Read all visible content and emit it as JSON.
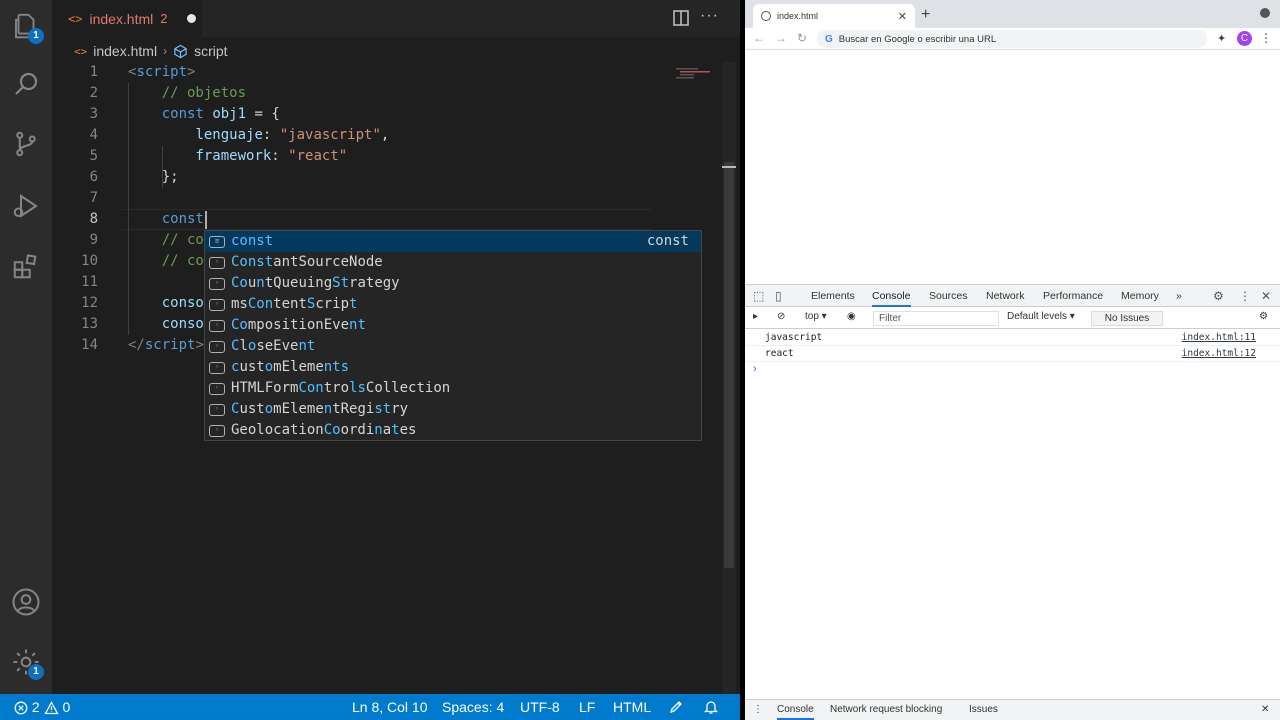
{
  "vscode": {
    "tab": {
      "icon": "<>",
      "name": "index.html",
      "problems": "2"
    },
    "breadcrumb": {
      "file": "index.html",
      "symbol": "script"
    },
    "activity": {
      "explorer_badge": "1",
      "settings_badge": "1"
    },
    "code_lines": [
      {
        "n": "1",
        "parts": [
          {
            "c": "t-tag",
            "t": "<"
          },
          {
            "c": "t-tagname",
            "t": "script"
          },
          {
            "c": "t-tag",
            "t": ">"
          }
        ]
      },
      {
        "n": "2",
        "parts": [
          {
            "c": "t-pl",
            "t": "    "
          },
          {
            "c": "t-cmt",
            "t": "// objetos"
          }
        ]
      },
      {
        "n": "3",
        "parts": [
          {
            "c": "t-pl",
            "t": "    "
          },
          {
            "c": "t-kw",
            "t": "const"
          },
          {
            "c": "t-pl",
            "t": " "
          },
          {
            "c": "t-var",
            "t": "obj1"
          },
          {
            "c": "t-pl",
            "t": " = {"
          }
        ]
      },
      {
        "n": "4",
        "parts": [
          {
            "c": "t-pl",
            "t": "        "
          },
          {
            "c": "t-var",
            "t": "lenguaje"
          },
          {
            "c": "t-pl",
            "t": ": "
          },
          {
            "c": "t-str",
            "t": "\"javascript\""
          },
          {
            "c": "t-pl",
            "t": ","
          }
        ]
      },
      {
        "n": "5",
        "parts": [
          {
            "c": "t-pl",
            "t": "        "
          },
          {
            "c": "t-var",
            "t": "framework"
          },
          {
            "c": "t-pl",
            "t": ": "
          },
          {
            "c": "t-str",
            "t": "\"react\""
          }
        ]
      },
      {
        "n": "6",
        "parts": [
          {
            "c": "t-pl",
            "t": "    };"
          }
        ]
      },
      {
        "n": "7",
        "parts": []
      },
      {
        "n": "8",
        "parts": [
          {
            "c": "t-pl",
            "t": "    "
          },
          {
            "c": "t-kw",
            "t": "const"
          }
        ]
      },
      {
        "n": "9",
        "parts": [
          {
            "c": "t-pl",
            "t": "    "
          },
          {
            "c": "t-cmt",
            "t": "// co"
          }
        ]
      },
      {
        "n": "10",
        "parts": [
          {
            "c": "t-pl",
            "t": "    "
          },
          {
            "c": "t-cmt",
            "t": "// co"
          }
        ]
      },
      {
        "n": "11",
        "parts": []
      },
      {
        "n": "12",
        "parts": [
          {
            "c": "t-pl",
            "t": "    "
          },
          {
            "c": "t-var",
            "t": "conso"
          }
        ]
      },
      {
        "n": "13",
        "parts": [
          {
            "c": "t-pl",
            "t": "    "
          },
          {
            "c": "t-var",
            "t": "conso"
          }
        ]
      },
      {
        "n": "14",
        "parts": [
          {
            "c": "t-tag",
            "t": "</"
          },
          {
            "c": "t-tagname",
            "t": "script"
          },
          {
            "c": "t-tag",
            "t": ">"
          }
        ]
      }
    ],
    "suggestions": [
      {
        "parts": [
          {
            "h": true,
            "t": "const"
          }
        ],
        "detail": "const",
        "selected": true,
        "icon": "keyword"
      },
      {
        "parts": [
          {
            "h": true,
            "t": "Const"
          },
          {
            "h": false,
            "t": "antSourceNode"
          }
        ],
        "icon": "variable"
      },
      {
        "parts": [
          {
            "h": true,
            "t": "Co"
          },
          {
            "h": false,
            "t": "u"
          },
          {
            "h": true,
            "t": "n"
          },
          {
            "h": false,
            "t": "tQueuing"
          },
          {
            "h": true,
            "t": "St"
          },
          {
            "h": false,
            "t": "rategy"
          }
        ],
        "icon": "variable"
      },
      {
        "parts": [
          {
            "h": false,
            "t": "ms"
          },
          {
            "h": true,
            "t": "Con"
          },
          {
            "h": false,
            "t": "tent"
          },
          {
            "h": true,
            "t": "S"
          },
          {
            "h": false,
            "t": "crip"
          },
          {
            "h": true,
            "t": "t"
          }
        ],
        "icon": "variable"
      },
      {
        "parts": [
          {
            "h": true,
            "t": "Co"
          },
          {
            "h": false,
            "t": "mpositionEve"
          },
          {
            "h": true,
            "t": "nt"
          }
        ],
        "icon": "variable"
      },
      {
        "parts": [
          {
            "h": true,
            "t": "C"
          },
          {
            "h": false,
            "t": "l"
          },
          {
            "h": true,
            "t": "o"
          },
          {
            "h": false,
            "t": "seEve"
          },
          {
            "h": true,
            "t": "nt"
          }
        ],
        "icon": "variable"
      },
      {
        "parts": [
          {
            "h": true,
            "t": "c"
          },
          {
            "h": false,
            "t": "ust"
          },
          {
            "h": true,
            "t": "o"
          },
          {
            "h": false,
            "t": "mEleme"
          },
          {
            "h": true,
            "t": "nts"
          }
        ],
        "icon": "variable"
      },
      {
        "parts": [
          {
            "h": false,
            "t": "HTMLForm"
          },
          {
            "h": true,
            "t": "Con"
          },
          {
            "h": false,
            "t": "tro"
          },
          {
            "h": true,
            "t": "ls"
          },
          {
            "h": false,
            "t": "Collection"
          }
        ],
        "icon": "variable"
      },
      {
        "parts": [
          {
            "h": true,
            "t": "C"
          },
          {
            "h": false,
            "t": "ust"
          },
          {
            "h": true,
            "t": "o"
          },
          {
            "h": false,
            "t": "mEleme"
          },
          {
            "h": true,
            "t": "n"
          },
          {
            "h": false,
            "t": "tRegi"
          },
          {
            "h": true,
            "t": "st"
          },
          {
            "h": false,
            "t": "ry"
          }
        ],
        "icon": "variable"
      },
      {
        "parts": [
          {
            "h": false,
            "t": "Geolocation"
          },
          {
            "h": true,
            "t": "Co"
          },
          {
            "h": false,
            "t": "ordi"
          },
          {
            "h": true,
            "t": "n"
          },
          {
            "h": false,
            "t": "a"
          },
          {
            "h": true,
            "t": "t"
          },
          {
            "h": false,
            "t": "es"
          }
        ],
        "icon": "variable"
      }
    ],
    "status": {
      "errors": "2",
      "warnings": "0",
      "position": "Ln 8, Col 10",
      "spaces": "Spaces: 4",
      "encoding": "UTF-8",
      "eol": "LF",
      "language": "HTML"
    }
  },
  "chrome": {
    "tab_title": "index.html",
    "omnibox_placeholder": "Buscar en Google o escribir una URL",
    "profile_initial": "C",
    "devtools": {
      "tabs": [
        "Elements",
        "Console",
        "Sources",
        "Network",
        "Performance",
        "Memory"
      ],
      "active_tab": "Console",
      "more": "»",
      "context": "top",
      "filter_placeholder": "Filter",
      "levels": "Default levels",
      "issues": "No Issues",
      "logs": [
        {
          "message": "javascript",
          "source": "index.html:11"
        },
        {
          "message": "react",
          "source": "index.html:12"
        }
      ],
      "prompt": "›",
      "drawer_tabs": [
        "Console",
        "Network request blocking",
        "Issues"
      ]
    }
  },
  "colors": {
    "statusbar": "#007acc",
    "suggest_selected": "#04395e",
    "match_highlight": "#4fc1ff",
    "devtools_accent": "#1a73e8"
  }
}
